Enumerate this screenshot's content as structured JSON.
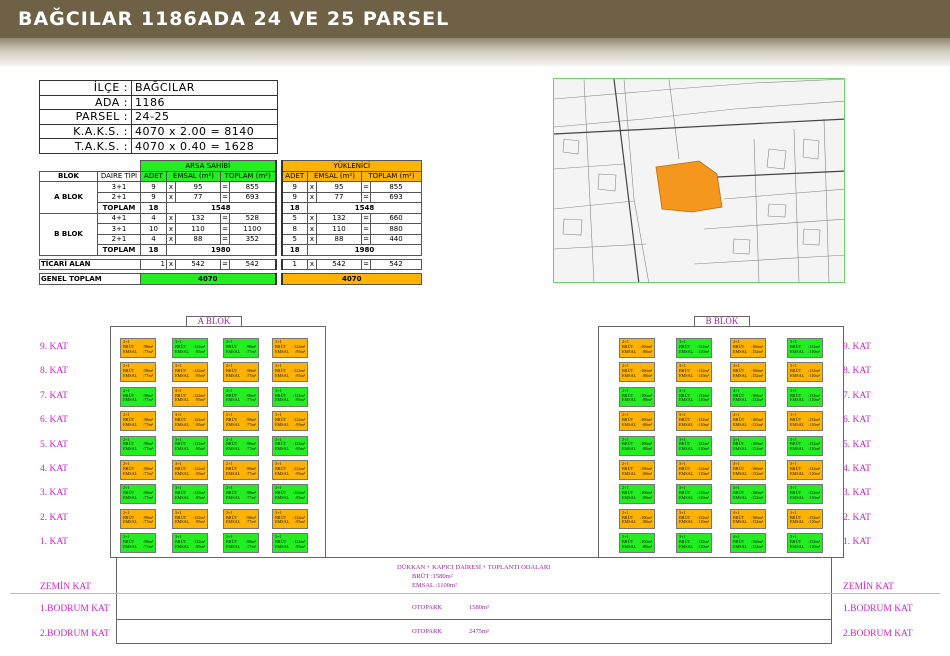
{
  "title": "BAĞCILAR 1186ADA 24 VE 25 PARSEL",
  "info": [
    {
      "k": "İLÇE :",
      "v": "BAĞCILAR"
    },
    {
      "k": "ADA :",
      "v": "1186"
    },
    {
      "k": "PARSEL :",
      "v": "24-25"
    },
    {
      "k": "K.A.K.S. :",
      "v": "4070 x 2.00 = 8140"
    },
    {
      "k": "T.A.K.S. :",
      "v": "4070 x 0.40 = 1628"
    }
  ],
  "area": {
    "h_blok": "BLOK",
    "h_tip": "DAİRE TİPİ",
    "h_arsa": "ARSA SAHİBİ",
    "h_yuk": "YÜKLENİCİ",
    "h_adet": "ADET",
    "h_emsal": "EMSAL (m²)",
    "h_toplam": "TOPLAM (m²)",
    "x": "x",
    "eq": "=",
    "a_blok": "A BLOK",
    "b_blok": "B BLOK",
    "toplam": "TOPLAM",
    "a_rows": [
      {
        "tip": "3+1",
        "a": [
          "9",
          "95",
          "855"
        ],
        "y": [
          "9",
          "95",
          "855"
        ]
      },
      {
        "tip": "2+1",
        "a": [
          "9",
          "77",
          "693"
        ],
        "y": [
          "9",
          "77",
          "693"
        ]
      }
    ],
    "a_total": {
      "a_adet": "18",
      "a_sum": "1548",
      "y_adet": "18",
      "y_sum": "1548"
    },
    "b_rows": [
      {
        "tip": "4+1",
        "a": [
          "4",
          "132",
          "528"
        ],
        "y": [
          "5",
          "132",
          "660"
        ]
      },
      {
        "tip": "3+1",
        "a": [
          "10",
          "110",
          "1100"
        ],
        "y": [
          "8",
          "110",
          "880"
        ]
      },
      {
        "tip": "2+1",
        "a": [
          "4",
          "88",
          "352"
        ],
        "y": [
          "5",
          "88",
          "440"
        ]
      }
    ],
    "b_total": {
      "a_adet": "18",
      "a_sum": "1980",
      "y_adet": "18",
      "y_sum": "1980"
    },
    "ticari": {
      "label": "TİCARİ ALAN",
      "a": [
        "1",
        "542",
        "542"
      ],
      "y": [
        "1",
        "542",
        "542"
      ]
    },
    "genel": {
      "label": "GENEL TOPLAM",
      "a": "4070",
      "y": "4070"
    }
  },
  "a_blok_label": "A BLOK",
  "b_blok_label": "B BLOK",
  "floors": [
    "9. KAT",
    "8. KAT",
    "7. KAT",
    "6. KAT",
    "5. KAT",
    "4. KAT",
    "3. KAT",
    "2. KAT",
    "1. KAT"
  ],
  "zemin": "ZEMİN KAT",
  "bodrum1": "1.BODRUM KAT",
  "bodrum2": "2.BODRUM KAT",
  "ground": {
    "line1": "DÜKKAN + KAPICI DAİRESİ + TOPLANTI ODALARI",
    "brut": "BRÜT    :1580m²",
    "emsal": "EMSAL  :1100m²",
    "otopark1_label": "OTOPARK",
    "otopark1_val": "1580m²",
    "otopark2_label": "OTOPARK",
    "otopark2_val": "2475m²"
  },
  "unit_words": {
    "brut": "BRÜT",
    "emsal": "EMSAL"
  },
  "a_units": [
    {
      "type": "2+1",
      "brut": ":98m²",
      "emsal": ":77m²"
    },
    {
      "type": "3+1",
      "brut": ":122m²",
      "emsal": ":95m²"
    },
    {
      "type": "2+1",
      "brut": ":98m²",
      "emsal": ":77m²"
    },
    {
      "type": "3+1",
      "brut": ":122m²",
      "emsal": ":95m²"
    }
  ],
  "b_units": [
    {
      "type": "2+1",
      "brut": ":106m²",
      "emsal": ":88m²"
    },
    {
      "type": "3+1",
      "brut": ":132m²",
      "emsal": ":110m²"
    },
    {
      "type": "4+1",
      "brut": ":166m²",
      "emsal": ":132m²"
    },
    {
      "type": "3+1",
      "brut": ":132m²",
      "emsal": ":110m²"
    }
  ],
  "a_colors": [
    [
      "o",
      "g",
      "g",
      "o"
    ],
    [
      "o",
      "o",
      "o",
      "o"
    ],
    [
      "g",
      "o",
      "g",
      "g"
    ],
    [
      "o",
      "o",
      "o",
      "o"
    ],
    [
      "g",
      "g",
      "g",
      "g"
    ],
    [
      "o",
      "o",
      "o",
      "o"
    ],
    [
      "g",
      "g",
      "g",
      "g"
    ],
    [
      "o",
      "o",
      "o",
      "o"
    ],
    [
      "g",
      "g",
      "g",
      "g"
    ]
  ],
  "b_colors": [
    [
      "o",
      "g",
      "o",
      "g"
    ],
    [
      "o",
      "o",
      "o",
      "o"
    ],
    [
      "g",
      "g",
      "g",
      "g"
    ],
    [
      "o",
      "o",
      "o",
      "o"
    ],
    [
      "g",
      "g",
      "g",
      "g"
    ],
    [
      "o",
      "o",
      "o",
      "o"
    ],
    [
      "g",
      "g",
      "g",
      "g"
    ],
    [
      "o",
      "o",
      "o",
      "o"
    ],
    [
      "g",
      "g",
      "g",
      "g"
    ]
  ],
  "colors": {
    "green": "#22ee22",
    "orange": "#ffb300",
    "header": "#6e6146",
    "label": "#cc22cc"
  }
}
